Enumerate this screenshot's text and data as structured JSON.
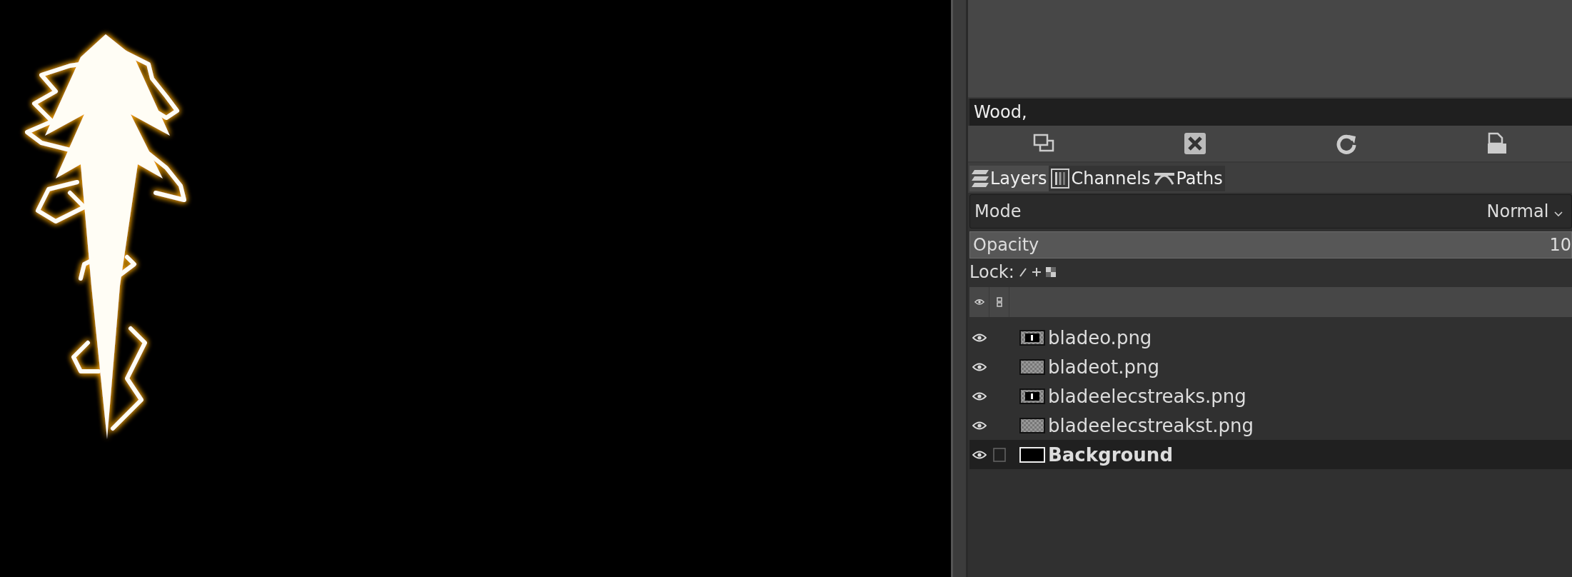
{
  "tags_field": {
    "value": "Wood,"
  },
  "tabs": [
    {
      "label": "Layers",
      "selected": true,
      "kind": "layers"
    },
    {
      "label": "Channels",
      "selected": false,
      "kind": "channels"
    },
    {
      "label": "Paths",
      "selected": false,
      "kind": "paths"
    }
  ],
  "mode": {
    "label": "Mode",
    "value": "Normal"
  },
  "opacity": {
    "label": "Opacity",
    "value": "10",
    "level": 1
  },
  "lock": {
    "label": "Lock:"
  },
  "layers": [
    {
      "name": "bladeo.png",
      "visible": true,
      "selected": false,
      "kind": "image"
    },
    {
      "name": "bladeot.png",
      "visible": true,
      "selected": false,
      "kind": "transparent"
    },
    {
      "name": "bladeelecstreaks.png",
      "visible": true,
      "selected": false,
      "kind": "image"
    },
    {
      "name": "bladeelecstreakst.png",
      "visible": true,
      "selected": false,
      "kind": "transparent"
    },
    {
      "name": "Background",
      "visible": true,
      "selected": true,
      "kind": "solid"
    }
  ]
}
